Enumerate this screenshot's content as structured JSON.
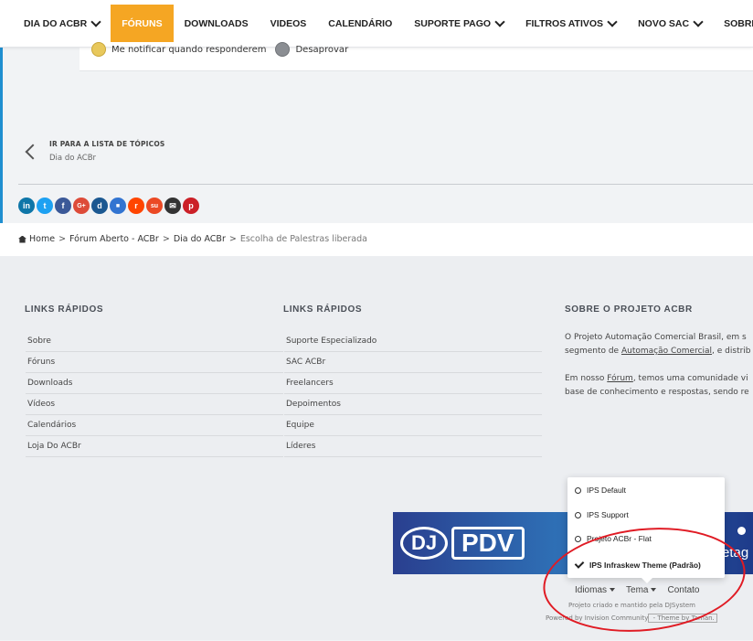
{
  "nav": {
    "items": [
      {
        "label": "DIA DO ACBR",
        "dropdown": true,
        "active": false
      },
      {
        "label": "FÓRUNS",
        "dropdown": false,
        "active": true
      },
      {
        "label": "DOWNLOADS",
        "dropdown": false,
        "active": false
      },
      {
        "label": "VIDEOS",
        "dropdown": false,
        "active": false
      },
      {
        "label": "CALENDÁRIO",
        "dropdown": false,
        "active": false
      },
      {
        "label": "SUPORTE PAGO",
        "dropdown": true,
        "active": false
      },
      {
        "label": "FILTROS ATIVOS",
        "dropdown": true,
        "active": false
      },
      {
        "label": "NOVO SAC",
        "dropdown": true,
        "active": false
      },
      {
        "label": "SOBRE",
        "dropdown": true,
        "active": false
      }
    ],
    "accent": "#f5a623"
  },
  "notify": {
    "option1": "Me notificar quando responderem",
    "option2": "Desaprovar"
  },
  "back": {
    "label": "IR PARA A LISTA DE TÓPICOS",
    "sub": "Dia do ACBr"
  },
  "social": [
    {
      "icon": "linkedin-icon",
      "glyph": "in",
      "color": "#0e76a8"
    },
    {
      "icon": "twitter-icon",
      "glyph": "t",
      "color": "#1da1f2"
    },
    {
      "icon": "facebook-icon",
      "glyph": "f",
      "color": "#3b5998"
    },
    {
      "icon": "google-plus-icon",
      "glyph": "G+",
      "color": "#dd4b39"
    },
    {
      "icon": "digg-icon",
      "glyph": "d",
      "color": "#1b5891"
    },
    {
      "icon": "delicious-icon",
      "glyph": "■",
      "color": "#3274d1"
    },
    {
      "icon": "reddit-icon",
      "glyph": "r",
      "color": "#ff4500"
    },
    {
      "icon": "stumbleupon-icon",
      "glyph": "su",
      "color": "#eb4924"
    },
    {
      "icon": "email-icon",
      "glyph": "✉",
      "color": "#333333"
    },
    {
      "icon": "pinterest-icon",
      "glyph": "p",
      "color": "#cb2027"
    }
  ],
  "breadcrumb": {
    "items": [
      "Home",
      "Fórum Aberto - ACBr",
      "Dia do ACBr"
    ],
    "current": "Escolha de Palestras liberada"
  },
  "footer": {
    "col1": {
      "title": "LINKS RÁPIDOS",
      "links": [
        "Sobre",
        "Fóruns",
        "Downloads",
        "Vídeos",
        "Calendários",
        "Loja Do ACBr"
      ]
    },
    "col2": {
      "title": "LINKS RÁPIDOS",
      "links": [
        "Suporte Especializado",
        "SAC ACBr",
        "Freelancers",
        "Depoimentos",
        "Equipe",
        "Líderes"
      ]
    },
    "col3": {
      "title": "SOBRE O PROJETO ACBR",
      "p1_line1": "O Projeto Automação Comercial Brasil, em s",
      "p1_line2_pre": "segmento de ",
      "p1_line2_link": "Automação Comercial",
      "p1_line2_post": ", e distrib",
      "p2_line1_pre": "Em nosso ",
      "p2_line1_link": "Fórum",
      "p2_line1_post": ", temos uma comunidade vi",
      "p2_line2": "base de conhecimento e respostas, sendo re"
    }
  },
  "banner": {
    "logo_dj": "DJ",
    "logo_pdv": "PDV",
    "text": "etag"
  },
  "theme_menu": {
    "items": [
      {
        "label": "IPS Default",
        "selected": false
      },
      {
        "label": "IPS Support",
        "selected": false
      },
      {
        "label": "Projeto ACBr - Flat",
        "selected": false
      },
      {
        "label": "IPS Infraskew Theme (Padrão)",
        "selected": true
      }
    ]
  },
  "footer_links": {
    "languages": "Idiomas",
    "theme": "Tema",
    "contact": "Contato"
  },
  "credits": {
    "line1": "Projeto criado e mantido pela DJSystem",
    "line2_pre": "Powered by ",
    "line2_link": "Invision Community",
    "line2_post": " - Theme by Taman."
  }
}
